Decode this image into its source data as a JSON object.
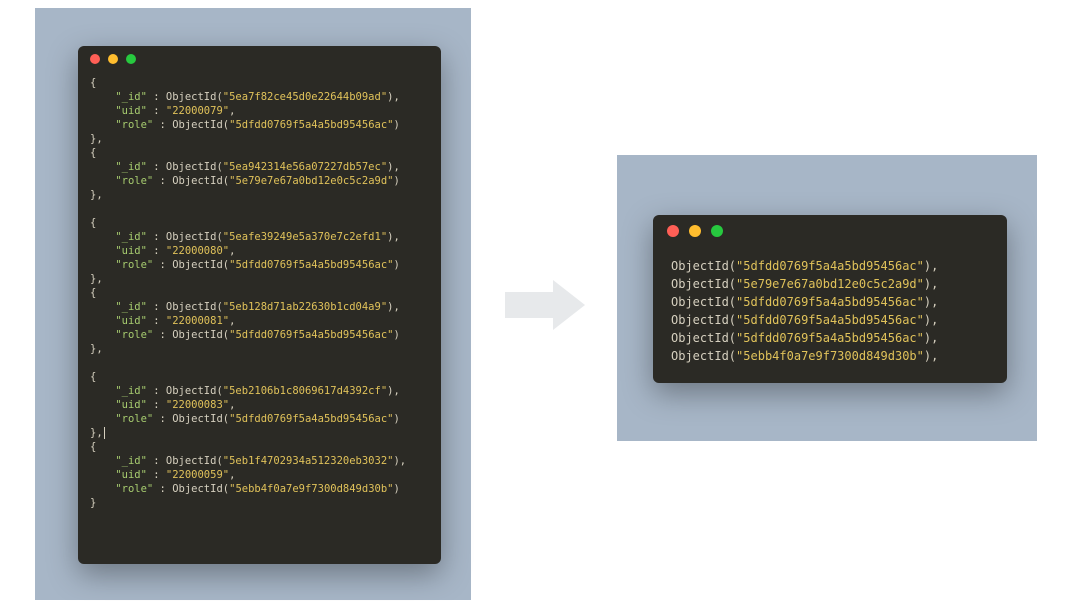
{
  "chart_data": {
    "type": "table",
    "title": "Extract role ObjectId from MongoDB documents",
    "left_documents": [
      {
        "_id": "5ea7f82ce45d0e22644b09ad",
        "uid": "22000079",
        "role": "5dfdd0769f5a4a5bd95456ac"
      },
      {
        "_id": "5ea942314e56a07227db57ec",
        "role": "5e79e7e67a0bd12e0c5c2a9d"
      },
      {
        "_id": "5eafe39249e5a370e7c2efd1",
        "uid": "22000080",
        "role": "5dfdd0769f5a4a5bd95456ac"
      },
      {
        "_id": "5eb128d71ab22630b1cd04a9",
        "uid": "22000081",
        "role": "5dfdd0769f5a4a5bd95456ac"
      },
      {
        "_id": "5eb2106b1c8069617d4392cf",
        "uid": "22000083",
        "role": "5dfdd0769f5a4a5bd95456ac"
      },
      {
        "_id": "5eb1f4702934a512320eb3032",
        "uid": "22000059",
        "role": "5ebb4f0a7e9f7300d849d30b"
      }
    ],
    "right_roles": [
      "5dfdd0769f5a4a5bd95456ac",
      "5e79e7e67a0bd12e0c5c2a9d",
      "5dfdd0769f5a4a5bd95456ac",
      "5dfdd0769f5a4a5bd95456ac",
      "5dfdd0769f5a4a5bd95456ac",
      "5ebb4f0a7e9f7300d849d30b"
    ]
  },
  "tokens": {
    "objectid": "ObjectId",
    "k_id": "\"_id\"",
    "k_uid": "\"uid\"",
    "k_role": "\"role\"",
    "open": "{",
    "close_comma": "},",
    "close": "}",
    "colon": " : ",
    "paren_open": "(",
    "paren_close_comma": "),",
    "paren_close": ")",
    "q": "\""
  },
  "left": {
    "d0": {
      "id": "5ea7f82ce45d0e22644b09ad",
      "uid": "22000079",
      "role": "5dfdd0769f5a4a5bd95456ac"
    },
    "d1": {
      "id": "5ea942314e56a07227db57ec",
      "role": "5e79e7e67a0bd12e0c5c2a9d"
    },
    "d2": {
      "id": "5eafe39249e5a370e7c2efd1",
      "uid": "22000080",
      "role": "5dfdd0769f5a4a5bd95456ac"
    },
    "d3": {
      "id": "5eb128d71ab22630b1cd04a9",
      "uid": "22000081",
      "role": "5dfdd0769f5a4a5bd95456ac"
    },
    "d4": {
      "id": "5eb2106b1c8069617d4392cf",
      "uid": "22000083",
      "role": "5dfdd0769f5a4a5bd95456ac"
    },
    "d5": {
      "id": "5eb1f4702934a512320eb3032",
      "uid": "22000059",
      "role": "5ebb4f0a7e9f7300d849d30b"
    }
  },
  "right": {
    "r0": "5dfdd0769f5a4a5bd95456ac",
    "r1": "5e79e7e67a0bd12e0c5c2a9d",
    "r2": "5dfdd0769f5a4a5bd95456ac",
    "r3": "5dfdd0769f5a4a5bd95456ac",
    "r4": "5dfdd0769f5a4a5bd95456ac",
    "r5": "5ebb4f0a7e9f7300d849d30b"
  }
}
